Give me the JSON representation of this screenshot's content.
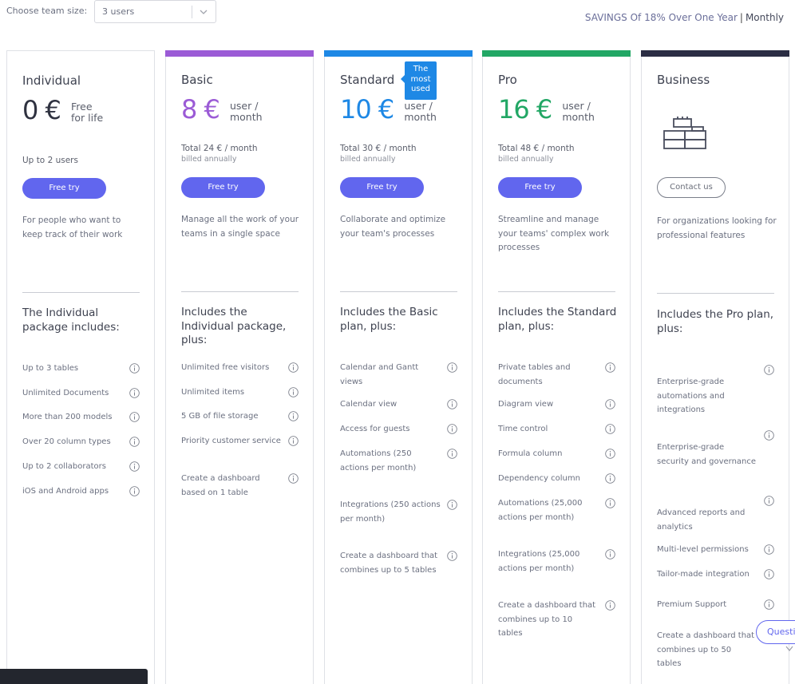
{
  "header": {
    "team_size_label": "Choose team size:",
    "team_size_value": "3 users",
    "savings_text": "SAVINGS Of 18% Over One Year",
    "separator": "|",
    "billing_period": "Monthly"
  },
  "colors": {
    "basic": "#9b5bd6",
    "standard": "#1e88e5",
    "pro": "#22a765",
    "business": "#2b2d44",
    "button": "#6166ee"
  },
  "plans": [
    {
      "name": "Individual",
      "price": "0 €",
      "price_line1": "Free",
      "price_line2": "for life",
      "users": "Up to 2 users",
      "button": "Free try",
      "description": "For people who want to keep track of their work",
      "includes": "The Individual package includes:",
      "features": [
        "Up to 3 tables",
        "Unlimited Documents",
        "More than 200 models",
        "Over 20 column types",
        "Up to 2 collaborators",
        "iOS and Android apps"
      ]
    },
    {
      "name": "Basic",
      "price": "8 €",
      "price_line1": "user /",
      "price_line2": "month",
      "total": "Total 24 € / month",
      "billed": "billed annually",
      "button": "Free try",
      "description": "Manage all the work of your teams in a single space",
      "includes": "Includes the Individual package, plus:",
      "features": [
        "Unlimited free visitors",
        "Unlimited items",
        "5 GB of file storage",
        "Priority customer service",
        "Create a dashboard based on 1 table"
      ]
    },
    {
      "name": "Standard",
      "badge": "The most used",
      "price": "10 €",
      "price_line1": "user /",
      "price_line2": "month",
      "total": "Total 30 € / month",
      "billed": "billed annually",
      "button": "Free try",
      "description": "Collaborate and optimize your team's processes",
      "includes": "Includes the Basic plan, plus:",
      "features": [
        "Calendar and Gantt views",
        "Calendar view",
        "Access for guests",
        "Automations (250 actions per month)",
        "Integrations (250 actions per month)",
        "Create a dashboard that combines up to 5 tables"
      ]
    },
    {
      "name": "Pro",
      "price": "16 €",
      "price_line1": "user /",
      "price_line2": "month",
      "total": "Total 48 € / month",
      "billed": "billed annually",
      "button": "Free try",
      "description": "Streamline and manage your teams' complex work processes",
      "includes": "Includes the Standard plan, plus:",
      "features": [
        "Private tables and documents",
        "Diagram view",
        "Time control",
        "Formula column",
        "Dependency column",
        "Automations (25,000 actions per month)",
        "Integrations (25,000 actions per month)",
        "Create a dashboard that combines up to 10 tables"
      ]
    },
    {
      "name": "Business",
      "icon": "blocks-icon",
      "button": "Contact us",
      "description": "For organizations looking for professional features",
      "includes": "Includes the Pro plan, plus:",
      "features": [
        "Enterprise-grade automations and integrations",
        "Enterprise-grade security and governance",
        "Advanced reports and analytics",
        "Multi-level permissions",
        "Tailor-made integration",
        "Premium Support",
        "Create a dashboard that combines up to 50 tables"
      ]
    }
  ],
  "help": {
    "question_button": "Questions"
  }
}
